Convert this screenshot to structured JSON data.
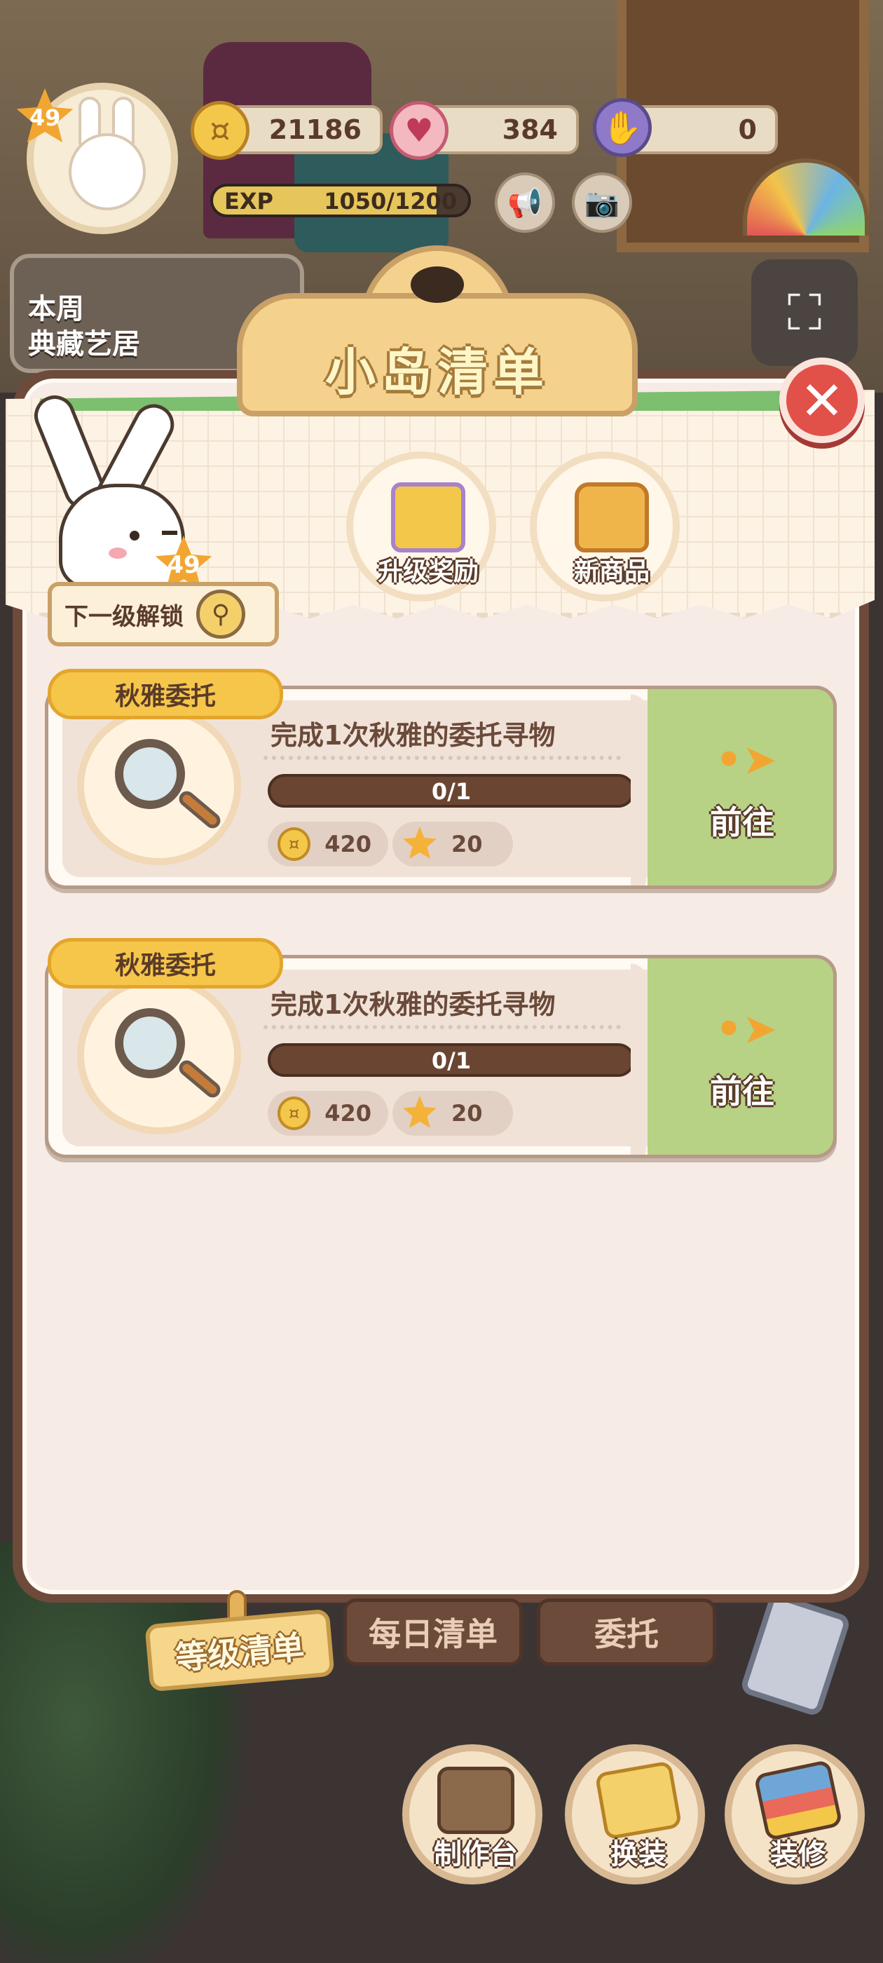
{
  "hud": {
    "player_level": "49",
    "coins": "21186",
    "hearts": "384",
    "energy": "0",
    "exp_label": "EXP",
    "exp_value": "1050/1200",
    "exp_progress": 0.875,
    "weekly_banner": [
      "本周",
      "典藏艺居"
    ]
  },
  "panel": {
    "title": "小岛清单",
    "bunny_level": "49",
    "next_unlock_label": "下一级解锁",
    "previews": [
      {
        "label": "升级奖励",
        "icon": "gift-box-icon"
      },
      {
        "label": "新商品",
        "icon": "bag-icon"
      }
    ],
    "tasks": [
      {
        "tag": "秋雅委托",
        "title": "完成1次秋雅的委托寻物",
        "progress_text": "0/1",
        "progress": 0,
        "reward_coins": "420",
        "reward_stars": "20",
        "go_label": "前往"
      },
      {
        "tag": "秋雅委托",
        "title": "完成1次秋雅的委托寻物",
        "progress_text": "0/1",
        "progress": 0,
        "reward_coins": "420",
        "reward_stars": "20",
        "go_label": "前往"
      }
    ]
  },
  "tabs": [
    {
      "label": "等级清单",
      "active": true
    },
    {
      "label": "每日清单",
      "active": false
    },
    {
      "label": "委托",
      "active": false
    }
  ],
  "bottom_buttons": [
    {
      "label": "制作台",
      "icon": "workbench-icon"
    },
    {
      "label": "换装",
      "icon": "outfit-icon"
    },
    {
      "label": "装修",
      "icon": "renovate-icon"
    }
  ],
  "colors": {
    "accent_green": "#b7d285",
    "coin_gold": "#f3c84a",
    "close_red": "#e2504a",
    "panel_brown": "#6e4a3a"
  }
}
